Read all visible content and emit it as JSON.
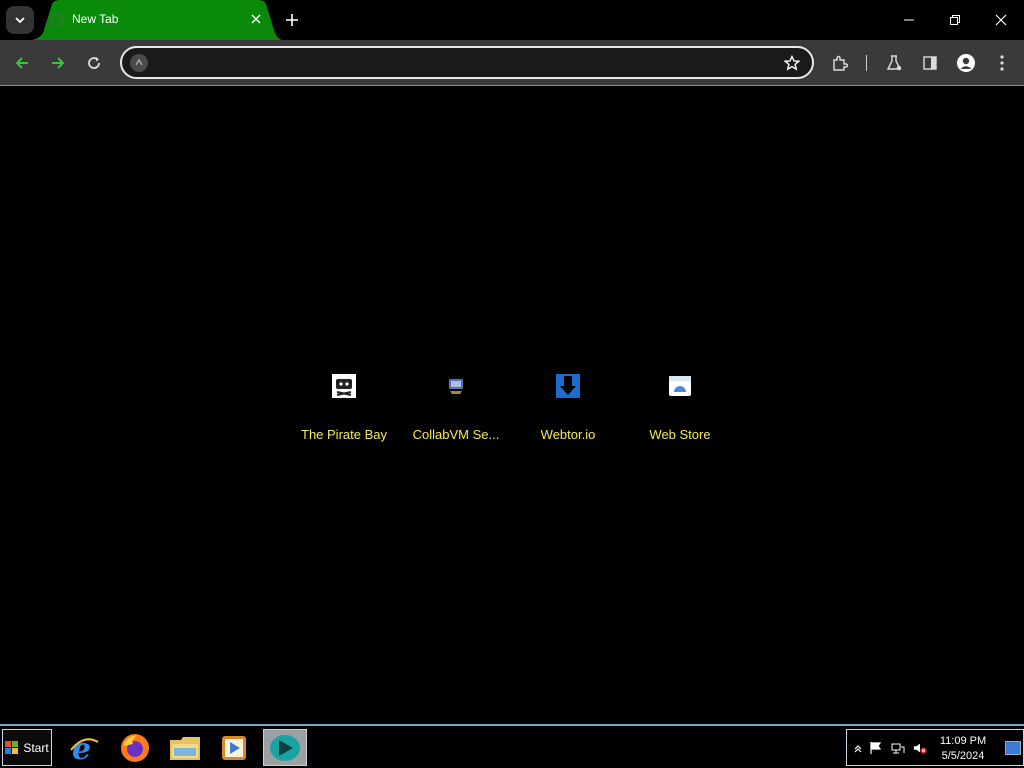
{
  "browser": {
    "tab": {
      "title": "New Tab",
      "active_color": "#0a8a0a"
    },
    "omnibox": {
      "value": "",
      "placeholder": ""
    },
    "accent_nav_color": "#3cc43c"
  },
  "shortcuts": [
    {
      "label": "The Pirate Bay",
      "icon": "pirate-bay-icon"
    },
    {
      "label": "CollabVM Se...",
      "icon": "collabvm-icon"
    },
    {
      "label": "Webtor.io",
      "icon": "webtor-icon"
    },
    {
      "label": "Web Store",
      "icon": "web-store-icon"
    }
  ],
  "taskbar": {
    "start_label": "Start",
    "apps": [
      {
        "name": "internet-explorer-icon"
      },
      {
        "name": "firefox-icon"
      },
      {
        "name": "file-explorer-icon"
      },
      {
        "name": "media-player-icon"
      },
      {
        "name": "chrome-app-icon",
        "active": true
      }
    ],
    "clock": {
      "time": "11:09 PM",
      "date": "5/5/2024"
    }
  }
}
